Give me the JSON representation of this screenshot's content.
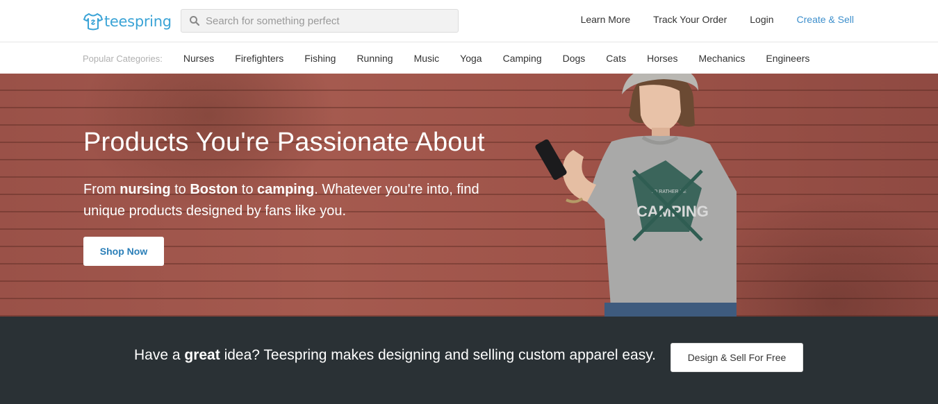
{
  "header": {
    "logo_text": "teespring",
    "search_placeholder": "Search for something perfect",
    "nav": {
      "learn_more": "Learn More",
      "track_order": "Track Your Order",
      "login": "Login",
      "create_sell": "Create & Sell"
    },
    "accent_color": "#3d8fcc"
  },
  "categories": {
    "label": "Popular Categories:",
    "items": [
      "Nurses",
      "Firefighters",
      "Fishing",
      "Running",
      "Music",
      "Yoga",
      "Camping",
      "Dogs",
      "Cats",
      "Horses",
      "Mechanics",
      "Engineers"
    ]
  },
  "hero": {
    "title": "Products You're Passionate About",
    "sub": {
      "p1": "From ",
      "b1": "nursing",
      "p2": " to ",
      "b2": "Boston",
      "p3": " to ",
      "b3": "camping",
      "p4": ". Whatever you're into, find unique products designed by fans like you."
    },
    "shop_button": "Shop Now",
    "shirt_text_top": "I'D RATHER BE",
    "shirt_text_main": "CAMPING"
  },
  "band": {
    "p1": "Have a ",
    "b1": "great",
    "p2": " idea? Teespring makes designing and selling custom apparel easy.",
    "button": "Design & Sell For Free",
    "background_color": "#2a3135"
  },
  "icons": [
    "teespring-shirt-icon",
    "search-icon"
  ]
}
